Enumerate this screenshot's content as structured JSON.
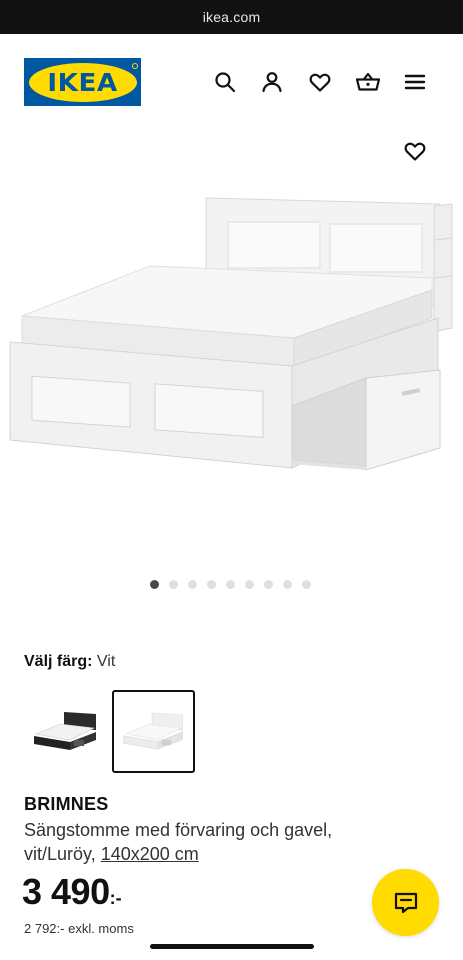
{
  "browser": {
    "url": "ikea.com"
  },
  "header": {
    "logo_text": "IKEA",
    "icons": [
      "search-icon",
      "user-icon",
      "heart-icon",
      "basket-icon",
      "menu-icon"
    ]
  },
  "gallery": {
    "total_images": 9,
    "active_index": 1
  },
  "color_select": {
    "label": "Välj färg:",
    "value": "Vit",
    "swatches": [
      {
        "name": "black-bed",
        "selected": false
      },
      {
        "name": "white-bed",
        "selected": true
      }
    ]
  },
  "product": {
    "name": "BRIMNES",
    "description": "Sängstomme med förvaring och gavel, vit/Luröy,",
    "size_link": "140x200 cm",
    "price": "3 490",
    "price_suffix": ":-",
    "vat_text": "2 792:- exkl. moms"
  },
  "colors": {
    "brand_blue": "#0058A3",
    "brand_yellow": "#FFDB00",
    "chat_button": "#FFDB00"
  }
}
